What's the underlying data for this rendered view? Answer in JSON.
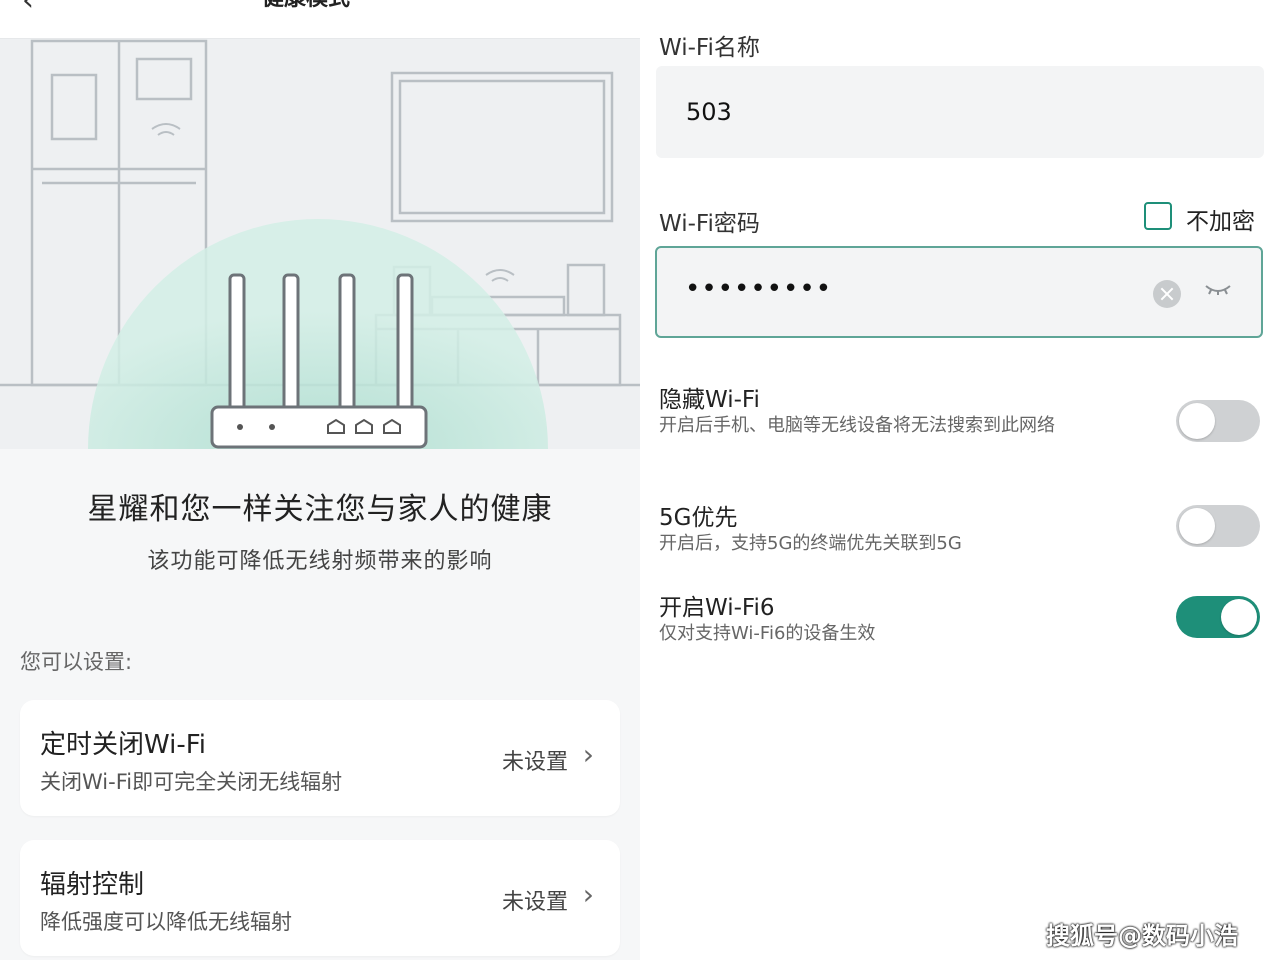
{
  "left": {
    "header_title": "健康模式",
    "headline": "星耀和您一样关注您与家人的健康",
    "subline": "该功能可降低无线射频带来的影响",
    "section_label": "您可以设置:",
    "cards": [
      {
        "title": "定时关闭Wi-Fi",
        "desc": "关闭Wi-Fi即可完全关闭无线辐射",
        "status": "未设置"
      },
      {
        "title": "辐射控制",
        "desc": "降低强度可以降低无线辐射",
        "status": "未设置"
      }
    ]
  },
  "right": {
    "wifi_name_label": "Wi-Fi名称",
    "wifi_name_value": "503",
    "wifi_password_label": "Wi-Fi密码",
    "no_encrypt_label": "不加密",
    "no_encrypt_checked": false,
    "password_masked": "•••••••••",
    "options": [
      {
        "title": "隐藏Wi-Fi",
        "desc": "开启后手机、电脑等无线设备将无法搜索到此网络",
        "enabled": false
      },
      {
        "title": "5G优先",
        "desc": "开启后，支持5G的终端优先关联到5G",
        "enabled": false
      },
      {
        "title": "开启Wi-Fi6",
        "desc": "仅对支持Wi-Fi6的设备生效",
        "enabled": true
      }
    ]
  },
  "watermark": "搜狐号@数码小浩",
  "colors": {
    "accent": "#1e8f79",
    "toggle_off": "#cfd1d3",
    "glow": "#bfe6da"
  }
}
